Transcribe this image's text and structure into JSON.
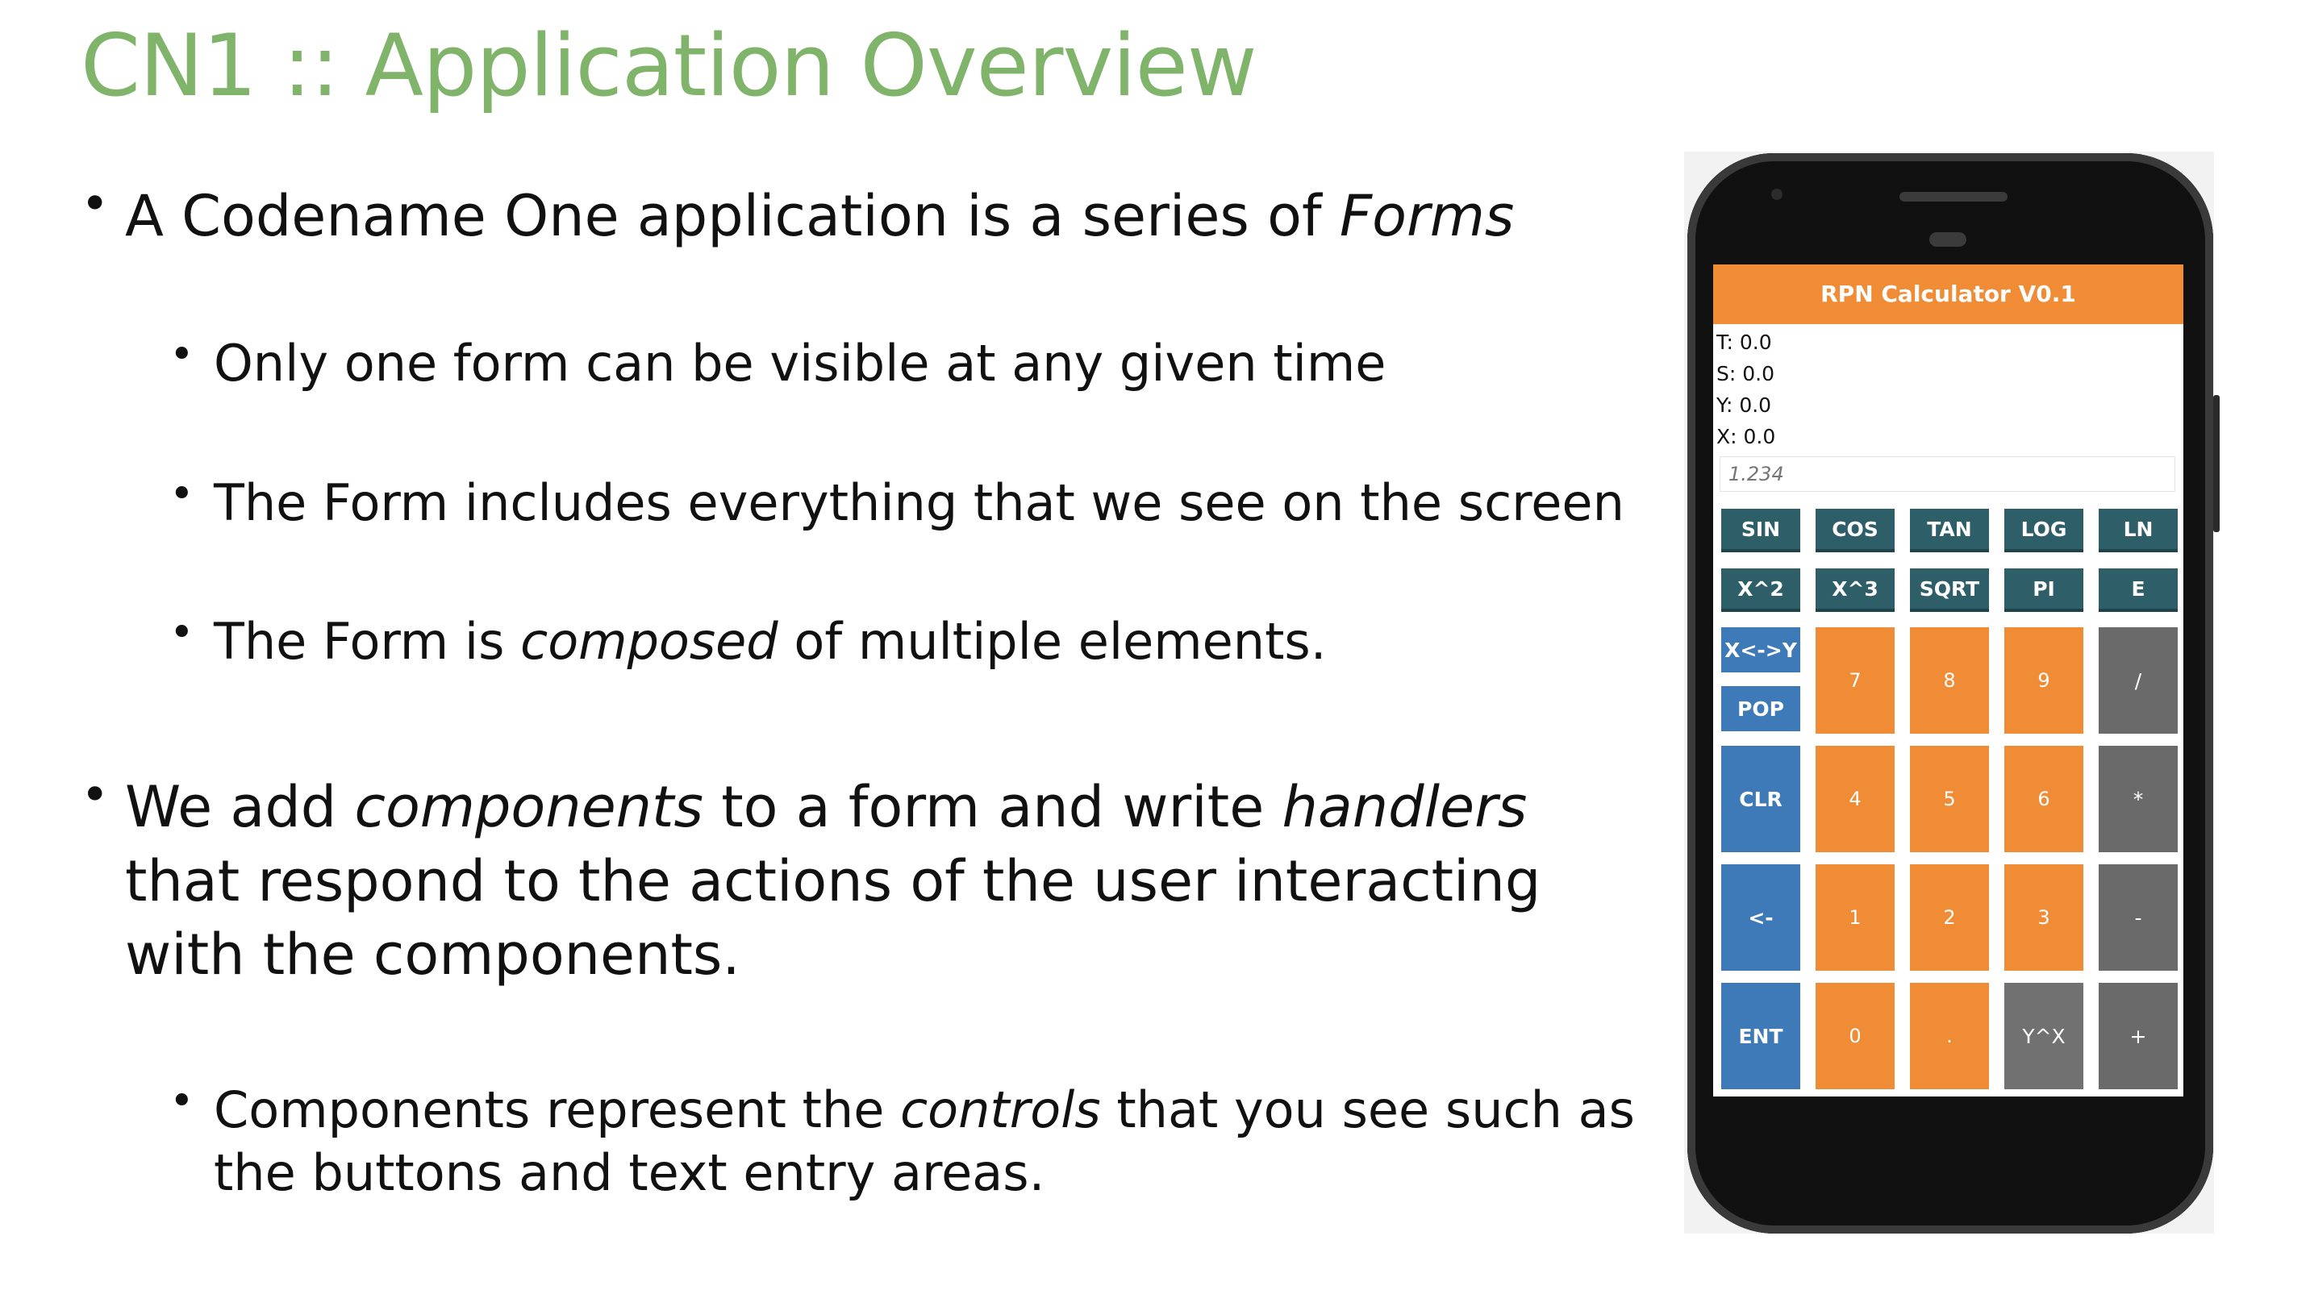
{
  "slide": {
    "title": "CN1 :: Application Overview",
    "bullets": [
      {
        "level": 1,
        "parts": [
          {
            "t": "A Codename One application is a series of "
          },
          {
            "t": "Forms",
            "i": true
          }
        ]
      },
      {
        "level": 2,
        "parts": [
          {
            "t": "Only one form can be visible at any given time"
          }
        ]
      },
      {
        "level": 2,
        "parts": [
          {
            "t": "The Form includes everything that we see on the screen"
          }
        ]
      },
      {
        "level": 2,
        "parts": [
          {
            "t": "The Form is "
          },
          {
            "t": "composed",
            "i": true
          },
          {
            "t": " of multiple elements."
          }
        ]
      },
      {
        "level": 1,
        "parts": [
          {
            "t": "We add "
          },
          {
            "t": "components",
            "i": true
          },
          {
            "t": " to a form and write "
          },
          {
            "t": "handlers",
            "i": true
          }
        ]
      },
      {
        "level": 1,
        "cont": true,
        "parts": [
          {
            "t": "that respond to the actions of the user interacting"
          }
        ]
      },
      {
        "level": 1,
        "cont": true,
        "parts": [
          {
            "t": "with the components."
          }
        ]
      },
      {
        "level": 2,
        "parts": [
          {
            "t": "Components represent the "
          },
          {
            "t": "controls",
            "i": true
          },
          {
            "t": " that you see such as"
          }
        ]
      },
      {
        "level": 2,
        "cont": true,
        "parts": [
          {
            "t": "the buttons and text entry areas."
          }
        ]
      }
    ],
    "bullet_char": "•"
  },
  "phone": {
    "app_title": "RPN Calculator V0.1",
    "registers": [
      "T: 0.0",
      "S: 0.0",
      "Y: 0.0",
      "X: 0.0"
    ],
    "input_placeholder": "1.234",
    "function_keys_row1": [
      "SIN",
      "COS",
      "TAN",
      "LOG",
      "LN"
    ],
    "function_keys_row2": [
      "X^2",
      "X^3",
      "SQRT",
      "PI",
      "E"
    ],
    "stack_keys": [
      "X<->Y",
      "POP"
    ],
    "side_keys": [
      "CLR",
      "<-",
      "ENT"
    ],
    "digit_keys": [
      "7",
      "8",
      "9",
      "4",
      "5",
      "6",
      "1",
      "2",
      "3",
      "0",
      "."
    ],
    "power_key": "Y^X",
    "operator_keys": [
      "/",
      "*",
      "-",
      "+"
    ],
    "colors": {
      "title": "#7fb46a",
      "appbar": "#f08b36",
      "teal_key": "#2e5f69",
      "blue_key": "#3e79b8",
      "orange_key": "#f08b36",
      "gray_key": "#717171"
    }
  }
}
